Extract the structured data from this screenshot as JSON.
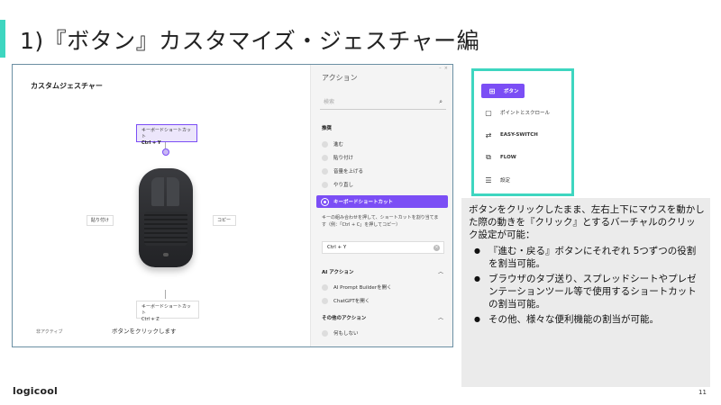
{
  "slide": {
    "title": "1)『ボタン』カスタマイズ・ジェスチャー編",
    "logo": "logicool",
    "page_number": "11"
  },
  "left_pane": {
    "title": "カスタムジェスチャー",
    "top_box": {
      "label": "キーボードショートカット",
      "shortcut": "Ctrl + Y"
    },
    "bottom_box": {
      "label": "キーボードショートカット",
      "shortcut": "Ctrl + Z"
    },
    "left_box": "貼り付け",
    "right_box": "コピー",
    "inactive_label": "非アクティブ",
    "hint": "ボタンをクリックします"
  },
  "right_pane": {
    "title": "アクション",
    "search_placeholder": "検索",
    "section_recommended": "推奨",
    "options": [
      "進む",
      "貼り付け",
      "音量を上げる",
      "やり直し"
    ],
    "selected_option": "キーボードショートカット",
    "description": "キーの組み合わせを押して、ショートカットを割り当てます（例：「Ctrl + C」を押してコピー）",
    "shortcut_value": "Ctrl + Y",
    "section_ai": "AI アクション",
    "ai_options": [
      "AI Prompt Builderを開く",
      "ChatGPTを開く"
    ],
    "section_other": "その他のアクション",
    "other_options": [
      "何もしない"
    ]
  },
  "menu": {
    "items": [
      {
        "label": "ボタン",
        "icon": "buttons-icon",
        "active": true
      },
      {
        "label": "ポイントとスクロール",
        "icon": "mouse-icon",
        "active": false
      },
      {
        "label": "EASY-SWITCH",
        "icon": "easy-switch-icon",
        "active": false
      },
      {
        "label": "FLOW",
        "icon": "flow-icon",
        "active": false
      },
      {
        "label": "設定",
        "icon": "settings-icon",
        "active": false
      }
    ]
  },
  "description": {
    "intro": "ボタンをクリックしたまま、左右上下にマウスを動かした際の動きを『クリック』とするバーチャルのクリック設定が可能：",
    "bullets": [
      "『進む・戻る』ボタンにそれぞれ 5つずつの役割を割当可能。",
      "ブラウザのタブ送り、スプレッドシートやプレゼンテーションツール等で使用するショートカットの割当可能。",
      "その他、様々な便利機能の割当が可能。"
    ]
  },
  "colors": {
    "accent_teal": "#3ed6c0",
    "accent_purple": "#7b4ef5"
  }
}
